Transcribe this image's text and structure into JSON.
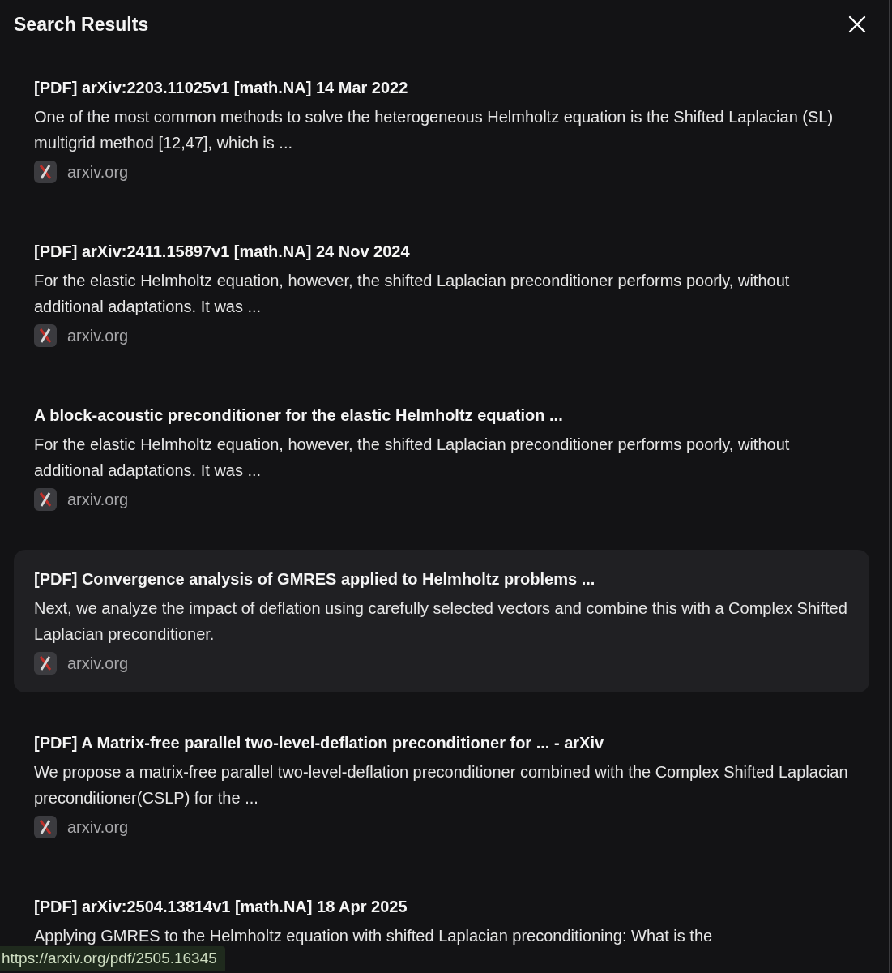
{
  "panel": {
    "title": "Search Results"
  },
  "results": [
    {
      "title": "[PDF] arXiv:2203.11025v1 [math.NA] 14 Mar 2022",
      "snippet": "One of the most common methods to solve the heterogeneous Helmholtz equation is the Shifted Laplacian (SL) multigrid method [12,47], which is ...",
      "source": "arxiv.org",
      "highlighted": false
    },
    {
      "title": "[PDF] arXiv:2411.15897v1 [math.NA] 24 Nov 2024",
      "snippet": "For the elastic Helmholtz equation, however, the shifted Laplacian preconditioner performs poorly, without additional adaptations. It was ...",
      "source": "arxiv.org",
      "highlighted": false
    },
    {
      "title": "A block-acoustic preconditioner for the elastic Helmholtz equation ...",
      "snippet": "For the elastic Helmholtz equation, however, the shifted Laplacian preconditioner performs poorly, without additional adaptations. It was ...",
      "source": "arxiv.org",
      "highlighted": false
    },
    {
      "title": "[PDF] Convergence analysis of GMRES applied to Helmholtz problems ...",
      "snippet": "Next, we analyze the impact of deflation using carefully selected vectors and combine this with a Complex Shifted Laplacian preconditioner.",
      "source": "arxiv.org",
      "highlighted": true
    },
    {
      "title": "[PDF] A Matrix-free parallel two-level-deflation preconditioner for ... - arXiv",
      "snippet": "We propose a matrix-free parallel two-level-deflation preconditioner combined with the Complex Shifted Laplacian preconditioner(CSLP) for the ...",
      "source": "arxiv.org",
      "highlighted": false
    },
    {
      "title": "[PDF] arXiv:2504.13814v1 [math.NA] 18 Apr 2025",
      "snippet": "Applying GMRES to the Helmholtz equation with shifted Laplacian preconditioning: What is the",
      "highlighted": false
    }
  ],
  "status_bar": {
    "url": "https://arxiv.org/pdf/2505.16345"
  }
}
